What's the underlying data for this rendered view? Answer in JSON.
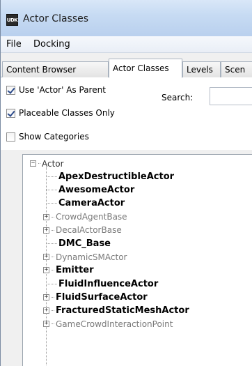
{
  "window": {
    "title": "Actor Classes",
    "app_icon_text": "UDK"
  },
  "menu": {
    "items": [
      "File",
      "Docking"
    ]
  },
  "tabs": {
    "items": [
      {
        "label": "Content Browser",
        "active": false
      },
      {
        "label": "Actor Classes",
        "active": true
      },
      {
        "label": "Levels",
        "active": false
      },
      {
        "label": "Scen",
        "active": false
      }
    ]
  },
  "options": {
    "use_actor_parent": {
      "label": "Use 'Actor' As Parent",
      "checked": true
    },
    "placeable_only": {
      "label": "Placeable Classes Only",
      "checked": true
    },
    "show_categories": {
      "label": "Show Categories",
      "checked": false
    },
    "search": {
      "label": "Search:",
      "value": "",
      "placeholder": ""
    }
  },
  "tree": {
    "root": {
      "label": "Actor",
      "expanded": true
    },
    "nodes": [
      {
        "label": "ApexDestructibleActor",
        "style": "bold",
        "expandable": false
      },
      {
        "label": "AwesomeActor",
        "style": "bold",
        "expandable": false
      },
      {
        "label": "CameraActor",
        "style": "bold",
        "expandable": false
      },
      {
        "label": "CrowdAgentBase",
        "style": "gray",
        "expandable": true
      },
      {
        "label": "DecalActorBase",
        "style": "gray",
        "expandable": true
      },
      {
        "label": "DMC_Base",
        "style": "bold",
        "expandable": false
      },
      {
        "label": "DynamicSMActor",
        "style": "gray",
        "expandable": true
      },
      {
        "label": "Emitter",
        "style": "bold",
        "expandable": true
      },
      {
        "label": "FluidInfluenceActor",
        "style": "bold",
        "expandable": false
      },
      {
        "label": "FluidSurfaceActor",
        "style": "bold",
        "expandable": true
      },
      {
        "label": "FracturedStaticMeshActor",
        "style": "bold",
        "expandable": true
      },
      {
        "label": "GameCrowdInteractionPoint",
        "style": "gray",
        "expandable": true
      }
    ]
  },
  "colors": {
    "titlebar": "#c7dbf3",
    "bold_text": "#000000",
    "gray_text": "#7a7a7a"
  }
}
